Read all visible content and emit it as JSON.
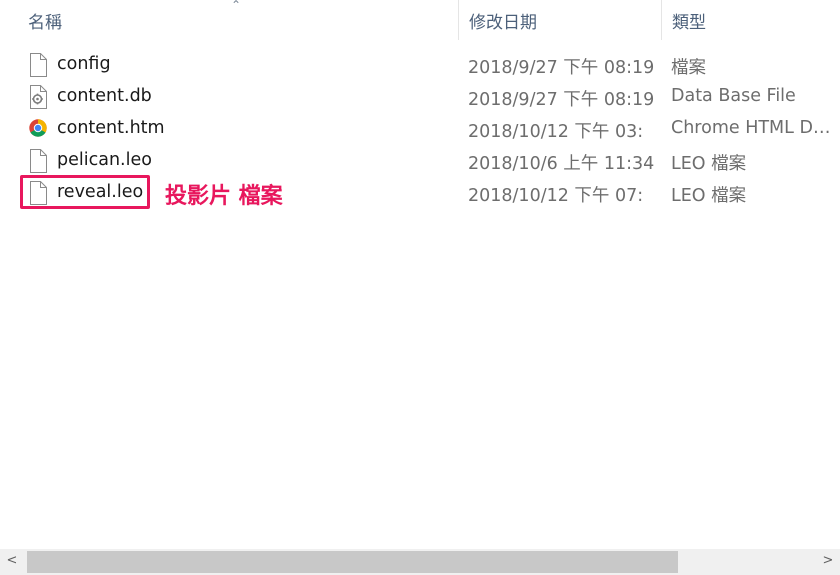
{
  "header": {
    "name": "名稱",
    "date_modified": "修改日期",
    "type": "類型"
  },
  "files": [
    {
      "name": "config",
      "date": "2018/9/27 下午 08:19",
      "type": "檔案",
      "icon": "file-icon"
    },
    {
      "name": "content.db",
      "date": "2018/9/27 下午 08:19",
      "type": "Data Base File",
      "icon": "database-file-icon"
    },
    {
      "name": "content.htm",
      "date": "2018/10/12 下午 03:",
      "type": "Chrome HTML Doc...",
      "icon": "chrome-icon"
    },
    {
      "name": "pelican.leo",
      "date": "2018/10/6 上午 11:34",
      "type": "LEO 檔案",
      "icon": "file-icon"
    },
    {
      "name": "reveal.leo",
      "date": "2018/10/12 下午 07:",
      "type": "LEO 檔案",
      "icon": "file-icon"
    }
  ],
  "annotation": "投影片 檔案",
  "colors": {
    "highlight": "#e8175d",
    "header_text": "#4c607a",
    "secondary_text": "#6d6d6d"
  },
  "scrollbar": {
    "left_arrow": "<",
    "right_arrow": ">"
  }
}
